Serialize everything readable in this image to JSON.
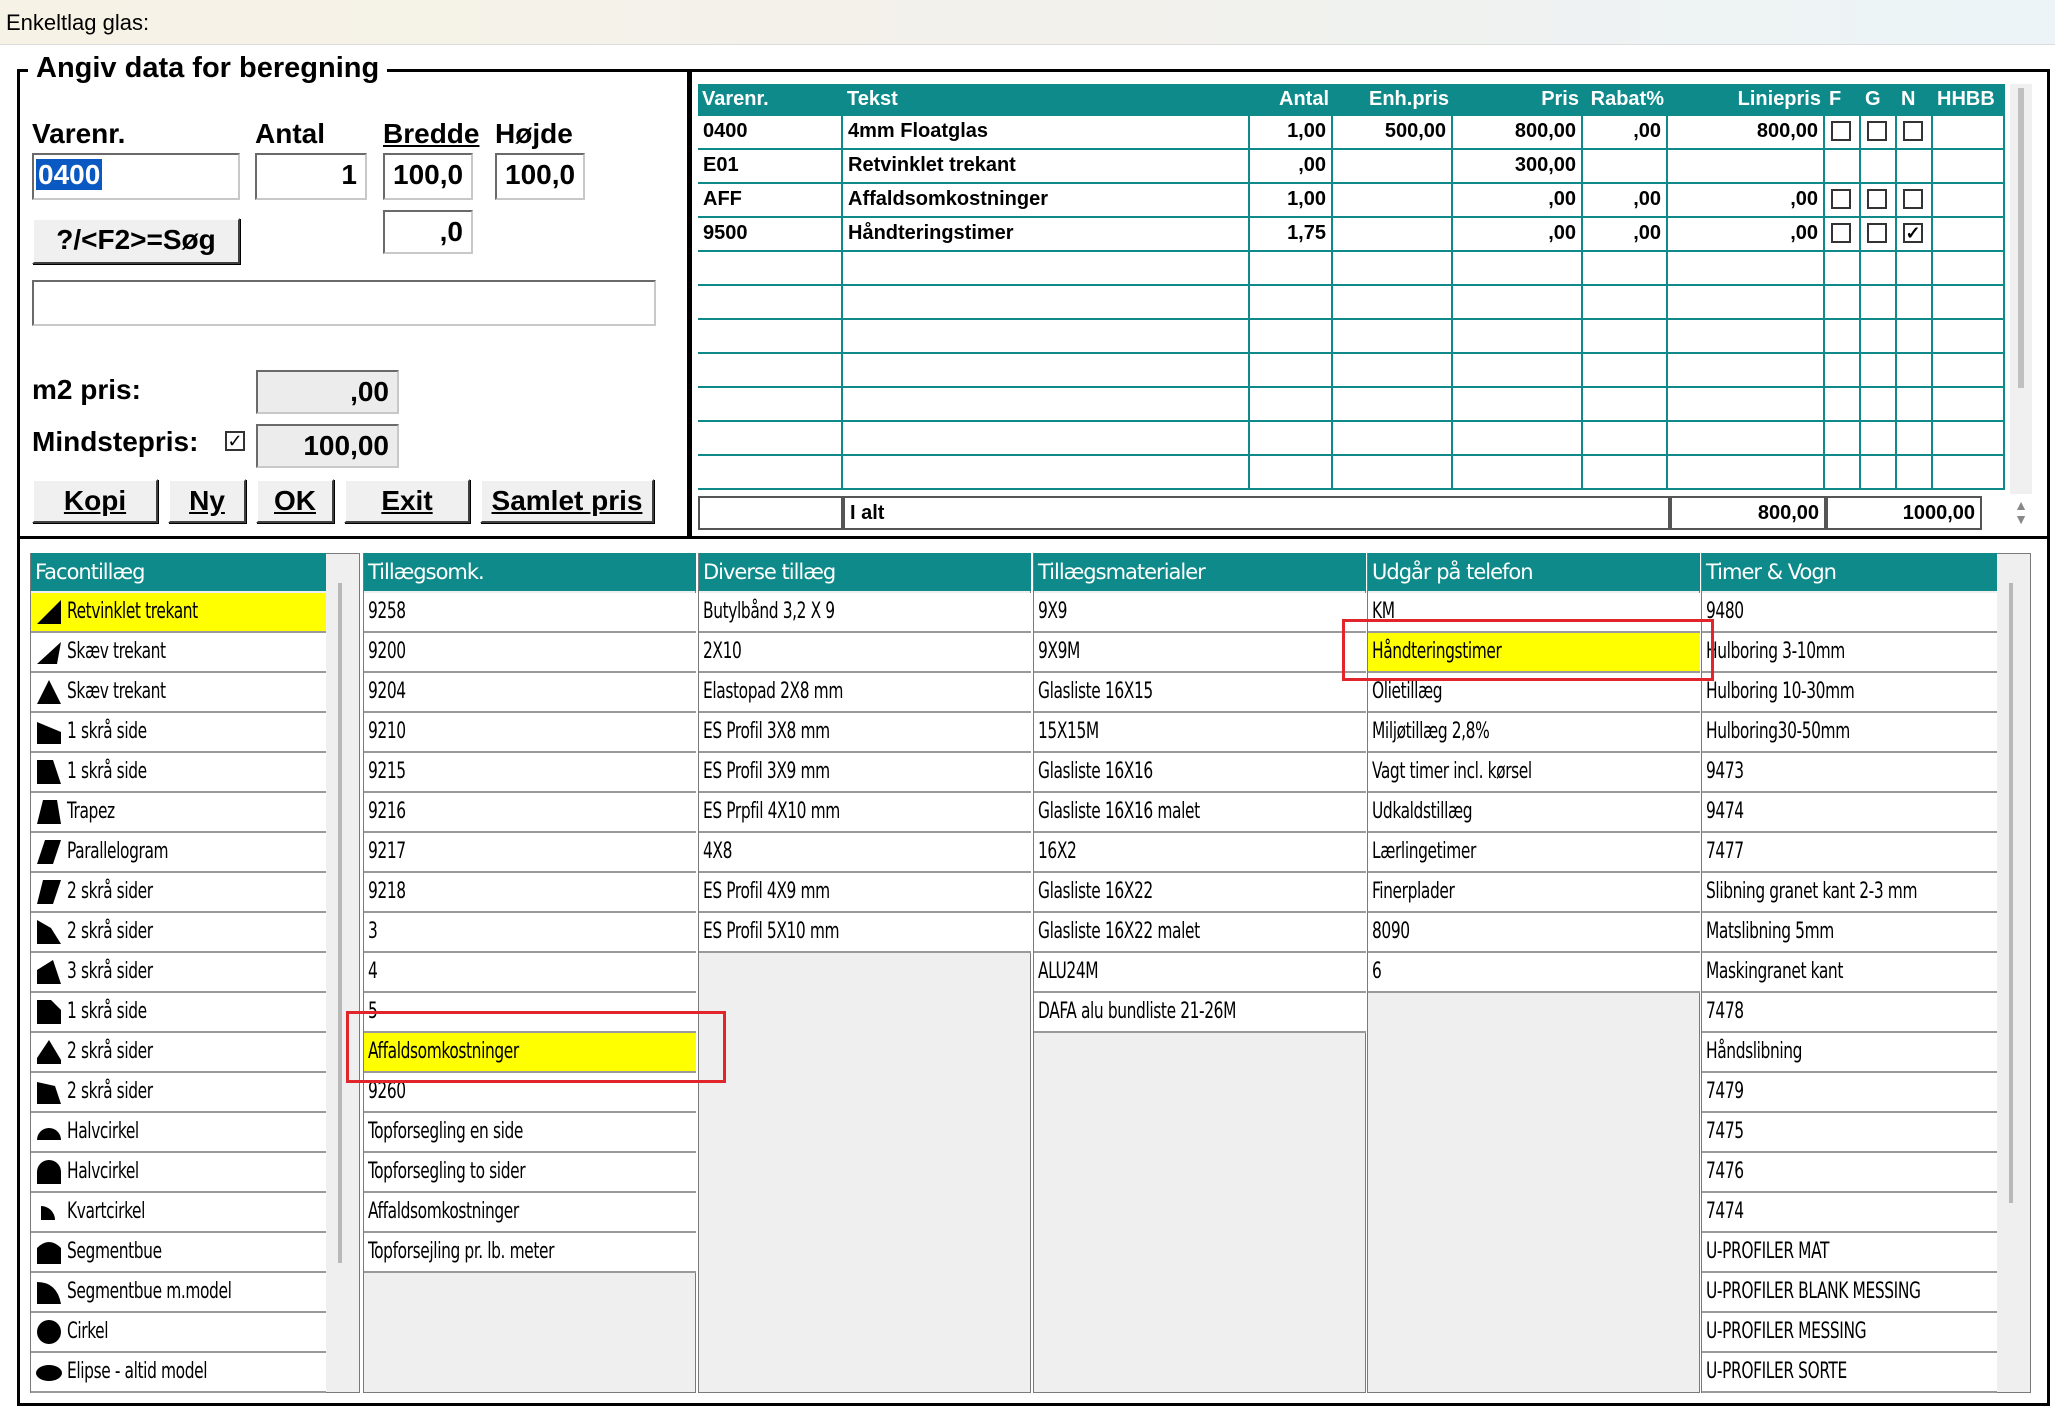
{
  "window": {
    "title": "Enkeltlag glas:"
  },
  "input_group": {
    "legend": "Angiv data for beregning",
    "varenr_label": "Varenr.",
    "antal_label": "Antal",
    "bredde_label": "Bredde",
    "hojde_label": "Højde",
    "varenr_value": "0400",
    "antal_value": "1",
    "bredde_value": "100,0",
    "hojde_value": "100,0",
    "extra_value": ",0",
    "search_button": "?/<F2>=Søg",
    "description_value": "",
    "m2_label": "m2 pris:",
    "m2_value": ",00",
    "mindstepris_label": "Mindstepris:",
    "mindstepris_checked": true,
    "mindstepris_value": "100,00",
    "buttons": {
      "kopi": "Kopi",
      "ny": "Ny",
      "ok": "OK",
      "exit": "Exit",
      "samlet": "Samlet pris"
    }
  },
  "order_grid": {
    "columns": [
      "Varenr.",
      "Tekst",
      "Antal",
      "Enh.pris",
      "Pris",
      "Rabat%",
      "Liniepris",
      "F",
      "G",
      "N",
      "HHBB"
    ],
    "rows": [
      {
        "varenr": "0400",
        "tekst": "4mm Floatglas",
        "antal": "1,00",
        "enhpris": "500,00",
        "pris": "800,00",
        "rabat": ",00",
        "liniepris": "800,00",
        "f": false,
        "g": false,
        "n": false
      },
      {
        "varenr": "E01",
        "tekst": "Retvinklet trekant",
        "antal": ",00",
        "enhpris": "",
        "pris": "300,00",
        "rabat": "",
        "liniepris": "",
        "f": null,
        "g": null,
        "n": null
      },
      {
        "varenr": "AFF",
        "tekst": "Affaldsomkostninger",
        "antal": "1,00",
        "enhpris": "",
        "pris": ",00",
        "rabat": ",00",
        "liniepris": ",00",
        "f": false,
        "g": false,
        "n": false
      },
      {
        "varenr": "9500",
        "tekst": "Håndteringstimer",
        "antal": "1,75",
        "enhpris": "",
        "pris": ",00",
        "rabat": ",00",
        "liniepris": ",00",
        "f": false,
        "g": false,
        "n": true
      }
    ],
    "total_label": "I alt",
    "total_value": "800,00",
    "total_value2": "1000,00"
  },
  "lists": [
    {
      "header": "Facontillæg",
      "items": [
        "Retvinklet trekant",
        "Skæv trekant",
        "Skæv trekant",
        "1 skrå side",
        "1 skrå side",
        "Trapez",
        "Parallelogram",
        "2 skrå sider",
        "2 skrå sider",
        "3 skrå sider",
        "1 skrå side",
        "2 skrå sider",
        "2 skrå sider",
        "Halvcirkel",
        "Halvcirkel",
        "Kvartcirkel",
        "Segmentbue",
        "Segmentbue m.model",
        "Cirkel",
        "Elipse - altid model"
      ],
      "highlight": 0
    },
    {
      "header": "Tillægsomk.",
      "items": [
        "9258",
        "9200",
        "9204",
        "9210",
        "9215",
        "9216",
        "9217",
        "9218",
        "3",
        "4",
        "5",
        "Affaldsomkostninger",
        "9260",
        "Topforsegling en side",
        "Topforsegling to sider",
        "Affaldsomkostninger",
        "Topforsejling pr. lb. meter"
      ],
      "highlight": 11
    },
    {
      "header": "Diverse tillæg",
      "items": [
        "Butylbånd 3,2 X 9",
        "2X10",
        "Elastopad 2X8 mm",
        "ES Profil 3X8 mm",
        "ES Profil 3X9 mm",
        "ES Prpfil 4X10 mm",
        "4X8",
        "ES Profil 4X9 mm",
        "ES Profil 5X10 mm"
      ],
      "highlight": -1
    },
    {
      "header": "Tillægsmaterialer",
      "items": [
        "9X9",
        "9X9M",
        "Glasliste 16X15",
        "15X15M",
        "Glasliste 16X16",
        "Glasliste 16X16 malet",
        "16X2",
        "Glasliste 16X22",
        "Glasliste 16X22 malet",
        "ALU24M",
        "DAFA alu bundliste 21-26M"
      ],
      "highlight": -1
    },
    {
      "header": "Udgår på telefon",
      "items": [
        "KM",
        "Håndteringstimer",
        "Olietillæg",
        "Miljøtillæg 2,8%",
        "Vagt timer incl. kørsel",
        "Udkaldstillæg",
        "Lærlingetimer",
        "Finerplader",
        "8090",
        "6"
      ],
      "highlight": 1
    },
    {
      "header": "Timer & Vogn",
      "items": [
        "9480",
        "Hulboring 3-10mm",
        "Hulboring 10-30mm",
        "Hulboring30-50mm",
        "9473",
        "9474",
        "7477",
        "Slibning granet kant 2-3 mm",
        "Matslibning 5mm",
        "Maskingranet kant",
        "7478",
        "Håndslibning",
        "7479",
        "7475",
        "7476",
        "7474",
        "U-PROFILER MAT",
        "U-PROFILER BLANK MESSING",
        "U-PROFILER MESSING",
        "U-PROFILER SORTE"
      ],
      "highlight": -1
    }
  ],
  "shape_icons": [
    "rt-triangle",
    "skew-triangle",
    "triangle",
    "one-slope",
    "one-slope-2",
    "trapezoid",
    "parallelogram",
    "two-slopes",
    "two-slopes-2",
    "three-slopes",
    "one-slope-3",
    "two-slopes-3",
    "two-slopes-4",
    "half-circle",
    "half-circle-2",
    "quarter-circle",
    "segment-arc",
    "segment-arc-model",
    "circle",
    "ellipse"
  ]
}
